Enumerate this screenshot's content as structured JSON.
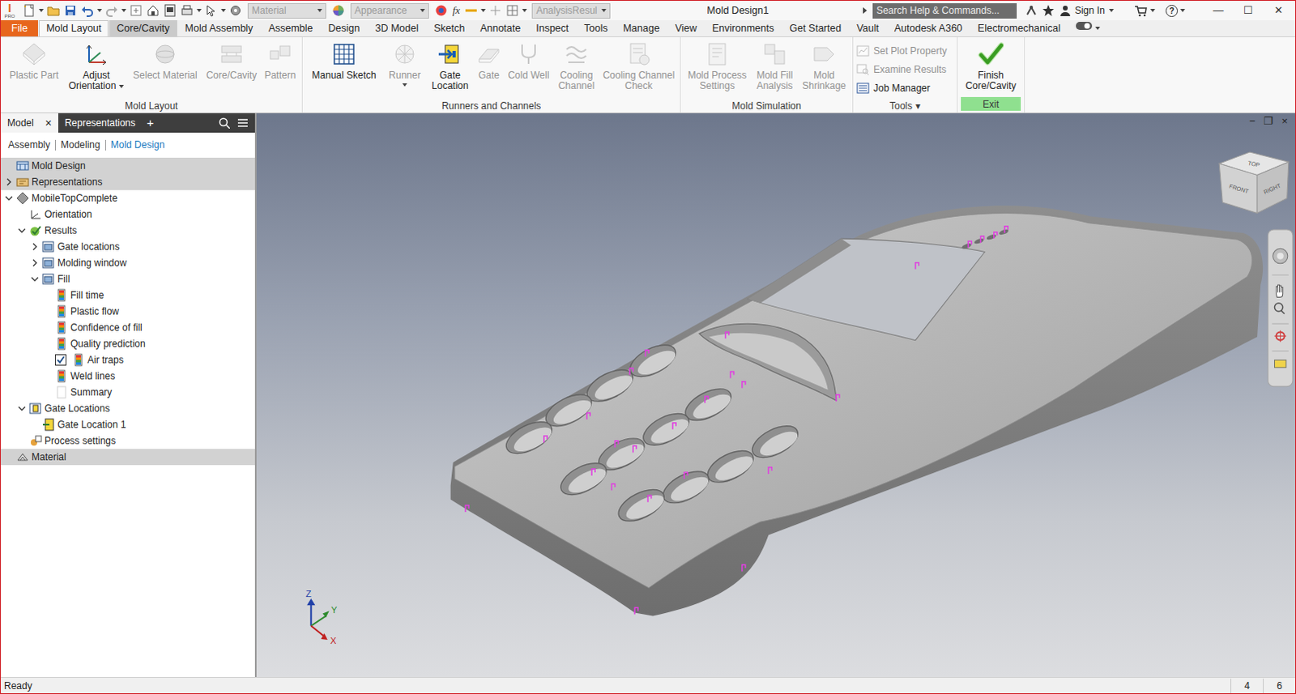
{
  "window": {
    "title": "Mold Design1",
    "buttons": [
      "—",
      "☐",
      "✕"
    ]
  },
  "app_logo": {
    "letter": "I",
    "edition": "PRO"
  },
  "quick_access": {
    "combos": [
      {
        "label": "Material",
        "enabled": false
      },
      {
        "label": "Appearance",
        "enabled": false
      },
      {
        "label": "AnalysisResul",
        "enabled": false
      }
    ],
    "fx": "fx",
    "search": {
      "placeholder": "Search Help & Commands..."
    },
    "user": {
      "label": "Sign In"
    },
    "help": "?"
  },
  "ribbon_tabs": [
    {
      "label": "File",
      "kind": "file",
      "selected": false
    },
    {
      "label": "Mold Layout",
      "kind": "tab",
      "selected": true
    },
    {
      "label": "Core/Cavity",
      "kind": "context",
      "selected": false
    },
    {
      "label": "Mold Assembly",
      "kind": "tab",
      "selected": false
    },
    {
      "label": "Assemble",
      "kind": "tab",
      "selected": false
    },
    {
      "label": "Design",
      "kind": "tab",
      "selected": false
    },
    {
      "label": "3D Model",
      "kind": "tab",
      "selected": false
    },
    {
      "label": "Sketch",
      "kind": "tab",
      "selected": false
    },
    {
      "label": "Annotate",
      "kind": "tab",
      "selected": false
    },
    {
      "label": "Inspect",
      "kind": "tab",
      "selected": false
    },
    {
      "label": "Tools",
      "kind": "tab",
      "selected": false
    },
    {
      "label": "Manage",
      "kind": "tab",
      "selected": false
    },
    {
      "label": "View",
      "kind": "tab",
      "selected": false
    },
    {
      "label": "Environments",
      "kind": "tab",
      "selected": false
    },
    {
      "label": "Get Started",
      "kind": "tab",
      "selected": false
    },
    {
      "label": "Vault",
      "kind": "tab",
      "selected": false
    },
    {
      "label": "Autodesk A360",
      "kind": "tab",
      "selected": false
    },
    {
      "label": "Electromechanical",
      "kind": "tab",
      "selected": false
    }
  ],
  "ribbon_groups": [
    {
      "label": "Mold Layout",
      "kind": "panel",
      "buttons": [
        {
          "label": "Plastic Part",
          "kind": "large",
          "enabled": false,
          "dropdown": false
        },
        {
          "label": "Adjust Orientation",
          "kind": "large",
          "enabled": true,
          "dropdown": true
        },
        {
          "label": "Select Material",
          "kind": "large",
          "enabled": false,
          "dropdown": false
        },
        {
          "label": "Core/Cavity",
          "kind": "large",
          "enabled": false,
          "dropdown": false
        },
        {
          "label": "Pattern",
          "kind": "large",
          "enabled": false,
          "dropdown": false
        }
      ]
    },
    {
      "label": "Runners and Channels",
      "kind": "panel",
      "buttons": [
        {
          "label": "Manual Sketch",
          "kind": "large",
          "enabled": true,
          "dropdown": false
        },
        {
          "label": "Runner",
          "kind": "large",
          "enabled": false,
          "dropdown": true
        },
        {
          "label": "Gate Location",
          "kind": "large",
          "enabled": true,
          "dropdown": false
        },
        {
          "label": "Gate",
          "kind": "large",
          "enabled": false,
          "dropdown": false
        },
        {
          "label": "Cold Well",
          "kind": "large",
          "enabled": false,
          "dropdown": false
        },
        {
          "label": "Cooling Channel",
          "kind": "large",
          "enabled": false,
          "dropdown": false
        },
        {
          "label": "Cooling Channel Check",
          "kind": "large",
          "enabled": false,
          "dropdown": false
        }
      ]
    },
    {
      "label": "Mold Simulation",
      "kind": "panel",
      "buttons": [
        {
          "label": "Mold Process Settings",
          "kind": "large",
          "enabled": false,
          "dropdown": false
        },
        {
          "label": "Mold Fill Analysis",
          "kind": "large",
          "enabled": false,
          "dropdown": false
        },
        {
          "label": "Mold Shrinkage",
          "kind": "large",
          "enabled": false,
          "dropdown": false
        }
      ]
    },
    {
      "label": "Tools",
      "menu": "▾",
      "kind": "panel",
      "buttons": [
        {
          "label": "Set Plot Property",
          "kind": "small",
          "enabled": false,
          "dropdown": false
        },
        {
          "label": "Examine Results",
          "kind": "small",
          "enabled": false,
          "dropdown": false
        },
        {
          "label": "Job Manager",
          "kind": "small",
          "enabled": true,
          "dropdown": false
        }
      ]
    },
    {
      "label": "Exit",
      "kind": "exit",
      "buttons": [
        {
          "label": "Finish Core/Cavity",
          "kind": "large",
          "enabled": true,
          "dropdown": false
        }
      ]
    }
  ],
  "browser": {
    "tabs": [
      {
        "label": "Model",
        "selected": true,
        "close": "×"
      },
      {
        "label": "Representations",
        "selected": false
      }
    ],
    "add": "+",
    "modes": [
      {
        "label": "Assembly",
        "selected": false
      },
      {
        "label": "Modeling",
        "selected": false
      },
      {
        "label": "Mold Design",
        "selected": true
      }
    ],
    "tree": [
      {
        "label": "Mold Design",
        "depth": 0,
        "kind": "assembly",
        "section": true,
        "expandable": false,
        "expanded": false,
        "checked": false
      },
      {
        "label": "Representations",
        "depth": 0,
        "kind": "representations",
        "section": true,
        "expandable": true,
        "expanded": false,
        "checked": false
      },
      {
        "label": "MobileTopComplete",
        "depth": 0,
        "kind": "part",
        "section": false,
        "expandable": true,
        "expanded": true,
        "checked": false
      },
      {
        "label": "Orientation",
        "depth": 1,
        "kind": "orientation",
        "section": false,
        "expandable": false,
        "expanded": false,
        "checked": false
      },
      {
        "label": "Results",
        "depth": 1,
        "kind": "results",
        "section": false,
        "expandable": true,
        "expanded": true,
        "checked": false
      },
      {
        "label": "Gate locations",
        "depth": 2,
        "kind": "folder",
        "section": false,
        "expandable": true,
        "expanded": false,
        "checked": false
      },
      {
        "label": "Molding window",
        "depth": 2,
        "kind": "folder",
        "section": false,
        "expandable": true,
        "expanded": false,
        "checked": false
      },
      {
        "label": "Fill",
        "depth": 2,
        "kind": "folder",
        "section": false,
        "expandable": true,
        "expanded": true,
        "checked": false
      },
      {
        "label": "Fill time",
        "depth": 3,
        "kind": "plot",
        "section": false,
        "expandable": false,
        "expanded": false,
        "checked": false
      },
      {
        "label": "Plastic flow",
        "depth": 3,
        "kind": "plot",
        "section": false,
        "expandable": false,
        "expanded": false,
        "checked": false
      },
      {
        "label": "Confidence of fill",
        "depth": 3,
        "kind": "plot",
        "section": false,
        "expandable": false,
        "expanded": false,
        "checked": false
      },
      {
        "label": "Quality prediction",
        "depth": 3,
        "kind": "plot",
        "section": false,
        "expandable": false,
        "expanded": false,
        "checked": false
      },
      {
        "label": "Air traps",
        "depth": 3,
        "kind": "plot",
        "section": false,
        "expandable": false,
        "expanded": false,
        "checked": true
      },
      {
        "label": "Weld lines",
        "depth": 3,
        "kind": "plot",
        "section": false,
        "expandable": false,
        "expanded": false,
        "checked": false
      },
      {
        "label": "Summary",
        "depth": 3,
        "kind": "summary",
        "section": false,
        "expandable": false,
        "expanded": false,
        "checked": false
      },
      {
        "label": "Gate Locations",
        "depth": 1,
        "kind": "gates",
        "section": false,
        "expandable": true,
        "expanded": true,
        "checked": false
      },
      {
        "label": "Gate Location 1",
        "depth": 2,
        "kind": "gate",
        "section": false,
        "expandable": false,
        "expanded": false,
        "checked": false
      },
      {
        "label": "Process settings",
        "depth": 1,
        "kind": "settings",
        "section": false,
        "expandable": false,
        "expanded": false,
        "checked": false
      },
      {
        "label": "Material",
        "depth": 0,
        "kind": "material",
        "section": true,
        "expandable": false,
        "expanded": false,
        "checked": false
      }
    ]
  },
  "viewport": {
    "window_buttons": [
      "−",
      "❐",
      "×"
    ],
    "viewcube": {
      "top": "TOP",
      "front": "FRONT",
      "right": "RIGHT"
    },
    "axes": {
      "x": "X",
      "y": "Y",
      "z": "Z"
    }
  },
  "status_bar": {
    "text": "Ready",
    "indicators": [
      "4",
      "6"
    ]
  }
}
